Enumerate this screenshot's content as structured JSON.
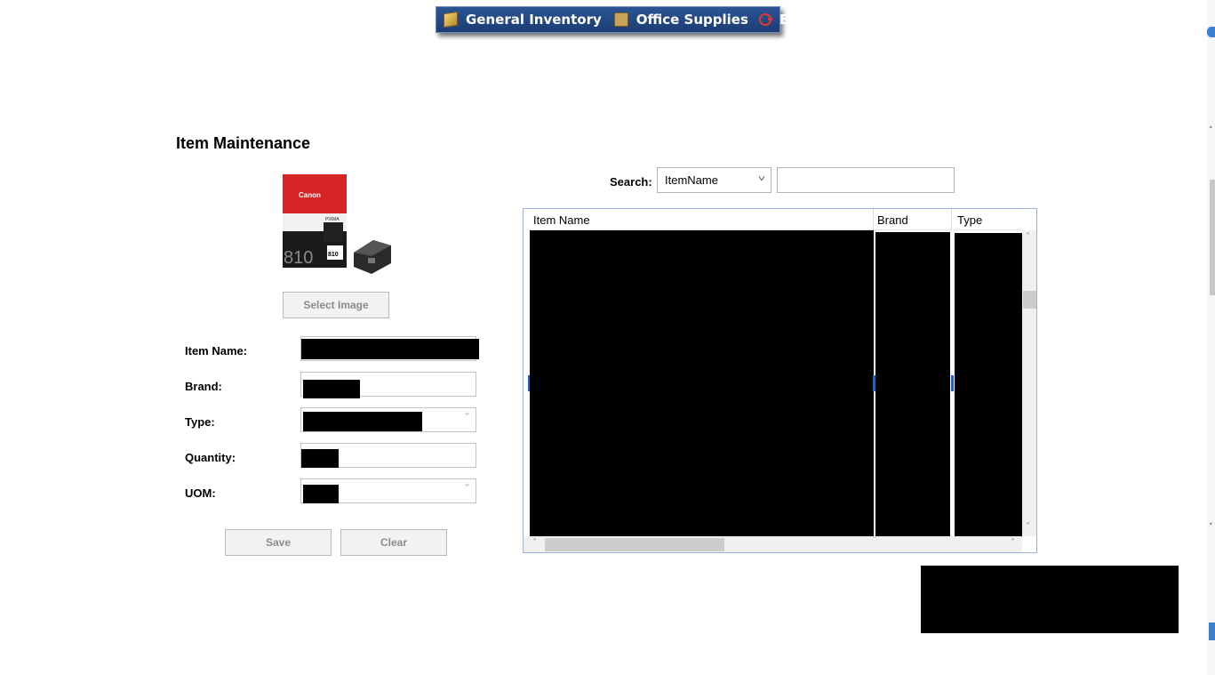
{
  "menu": {
    "items": [
      {
        "label": "General Inventory",
        "icon": "book-icon"
      },
      {
        "label": "Office Supplies",
        "icon": "box-icon"
      },
      {
        "label": "Exit",
        "icon": "exit-icon"
      }
    ]
  },
  "page": {
    "title": "Item Maintenance"
  },
  "image_panel": {
    "select_image_label": "Select Image",
    "product_brand": "Canon",
    "product_line": "PIXMA",
    "product_number": "810"
  },
  "form": {
    "item_name_label": "Item Name:",
    "brand_label": "Brand:",
    "type_label": "Type:",
    "quantity_label": "Quantity:",
    "uom_label": "UOM:",
    "save_label": "Save",
    "clear_label": "Clear"
  },
  "search": {
    "label": "Search:",
    "field_value": "ItemName",
    "query": ""
  },
  "grid": {
    "columns": [
      "Item Name",
      "Brand",
      "Type"
    ]
  },
  "colors": {
    "menu_bar": "#1c3d73",
    "selection_highlight": "#1e64c8",
    "redaction": "#000000"
  }
}
